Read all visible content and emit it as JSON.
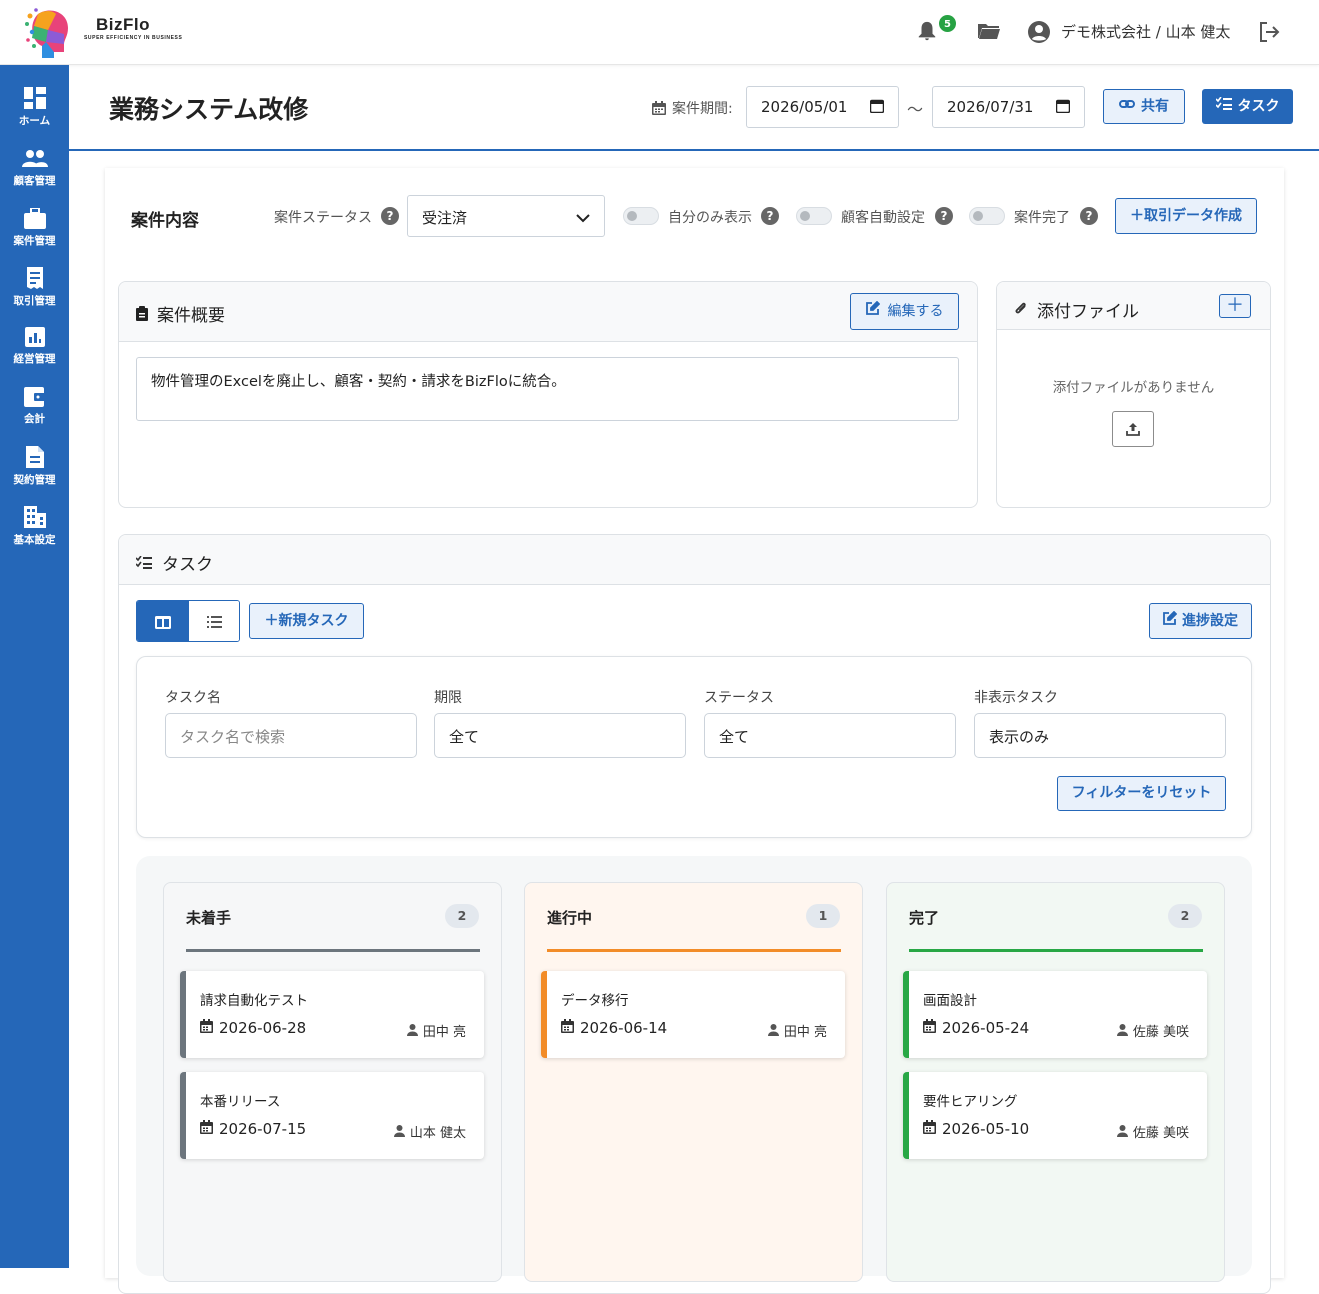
{
  "header": {
    "brand": "BizFlo",
    "brand_sub": "SUPER EFFICIENCY IN BUSINESS",
    "notification_count": "5",
    "user": "デモ株式会社 / 山本 健太"
  },
  "sidebar": {
    "items": [
      {
        "label": "ホーム",
        "icon": "dashboard-icon"
      },
      {
        "label": "顧客管理",
        "icon": "users-icon"
      },
      {
        "label": "案件管理",
        "icon": "briefcase-icon"
      },
      {
        "label": "取引管理",
        "icon": "receipt-icon"
      },
      {
        "label": "経営管理",
        "icon": "chart-icon"
      },
      {
        "label": "会計",
        "icon": "wallet-icon"
      },
      {
        "label": "契約管理",
        "icon": "document-icon"
      },
      {
        "label": "基本設定",
        "icon": "building-icon"
      }
    ]
  },
  "page": {
    "title": "業務システム改修",
    "period_label": "案件期間:",
    "start_date": "2026/05/01",
    "tilde": "～",
    "end_date": "2026/07/31",
    "share_label": "共有",
    "task_label": "タスク"
  },
  "details": {
    "title": "案件内容",
    "status_label": "案件ステータス",
    "status_value": "受注済",
    "toggle_self_only": "自分のみ表示",
    "toggle_customer_auto": "顧客自動設定",
    "toggle_complete": "案件完了",
    "create_transaction": "取引データ作成"
  },
  "overview": {
    "title": "案件概要",
    "edit_label": "編集する",
    "text": "物件管理のExcelを廃止し、顧客・契約・請求をBizFloに統合。"
  },
  "attachments": {
    "title": "添付ファイル",
    "empty": "添付ファイルがありません"
  },
  "tasks": {
    "title": "タスク",
    "new_task": "新規タスク",
    "progress_settings": "進捗設定",
    "filters": {
      "name_label": "タスク名",
      "name_placeholder": "タスク名で検索",
      "due_label": "期限",
      "due_value": "全て",
      "status_label": "ステータス",
      "status_value": "全て",
      "hidden_label": "非表示タスク",
      "hidden_value": "表示のみ",
      "reset": "フィルターをリセット"
    },
    "columns": [
      {
        "title": "未着手",
        "count": "2",
        "color": "#6c757d",
        "bg": "#f6f7f8",
        "cards": [
          {
            "name": "請求自動化テスト",
            "date": "2026-06-28",
            "assignee": "田中 亮"
          },
          {
            "name": "本番リリース",
            "date": "2026-07-15",
            "assignee": "山本 健太"
          }
        ]
      },
      {
        "title": "進行中",
        "count": "1",
        "color": "#f28c28",
        "bg": "#fff6ef",
        "cards": [
          {
            "name": "データ移行",
            "date": "2026-06-14",
            "assignee": "田中 亮"
          }
        ]
      },
      {
        "title": "完了",
        "count": "2",
        "color": "#28a745",
        "bg": "#f2f8f3",
        "cards": [
          {
            "name": "画面設計",
            "date": "2026-05-24",
            "assignee": "佐藤 美咲"
          },
          {
            "name": "要件ヒアリング",
            "date": "2026-05-10",
            "assignee": "佐藤 美咲"
          }
        ]
      }
    ]
  }
}
